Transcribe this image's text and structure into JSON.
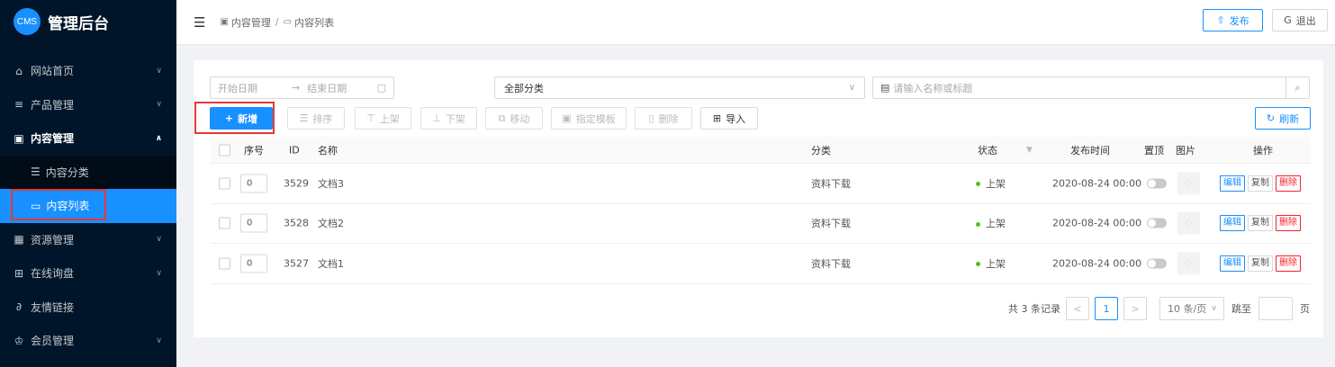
{
  "app": {
    "logo": "CMS",
    "title": "管理后台"
  },
  "sidebar": {
    "items": [
      {
        "label": "网站首页",
        "icon": "home-icon"
      },
      {
        "label": "产品管理",
        "icon": "product-icon"
      },
      {
        "label": "内容管理",
        "icon": "content-icon",
        "open": true
      },
      {
        "label": "资源管理",
        "icon": "resource-icon"
      },
      {
        "label": "在线询盘",
        "icon": "inquiry-icon"
      },
      {
        "label": "友情链接",
        "icon": "link-icon"
      },
      {
        "label": "会员管理",
        "icon": "member-icon"
      }
    ],
    "sub_items": [
      {
        "label": "内容分类",
        "icon": "category-icon"
      },
      {
        "label": "内容列表",
        "icon": "list-icon",
        "active": true
      }
    ]
  },
  "header": {
    "breadcrumb": [
      "内容管理",
      "内容列表"
    ],
    "publish": "发布",
    "logout": "退出"
  },
  "filters": {
    "start_placeholder": "开始日期",
    "end_placeholder": "结束日期",
    "category_value": "全部分类",
    "search_placeholder": "请输入名称或标题"
  },
  "toolbar": {
    "add": "新增",
    "sort": "排序",
    "on_shelf": "上架",
    "off_shelf": "下架",
    "move": "移动",
    "template": "指定模板",
    "delete": "删除",
    "import": "导入",
    "refresh": "刷新"
  },
  "table": {
    "columns": {
      "seq": "序号",
      "id": "ID",
      "name": "名称",
      "category": "分类",
      "status": "状态",
      "time": "发布时间",
      "top": "置顶",
      "image": "图片",
      "ops": "操作"
    },
    "rows": [
      {
        "seq": "0",
        "id": "3529",
        "name": "文档3",
        "category": "资料下载",
        "status": "上架",
        "time": "2020-08-24 00:00"
      },
      {
        "seq": "0",
        "id": "3528",
        "name": "文档2",
        "category": "资料下载",
        "status": "上架",
        "time": "2020-08-24 00:00"
      },
      {
        "seq": "0",
        "id": "3527",
        "name": "文档1",
        "category": "资料下载",
        "status": "上架",
        "time": "2020-08-24 00:00"
      }
    ],
    "ops": {
      "edit": "编辑",
      "copy": "复制",
      "delete": "删除"
    }
  },
  "pagination": {
    "total": "共 3 条记录",
    "prev": "<",
    "current": "1",
    "next": ">",
    "page_size": "10 条/页",
    "jump_label": "跳至",
    "page_unit": "页"
  },
  "colors": {
    "primary": "#1890ff",
    "sidebar_bg": "#001529",
    "danger": "#f5222d",
    "success": "#52c41a"
  }
}
